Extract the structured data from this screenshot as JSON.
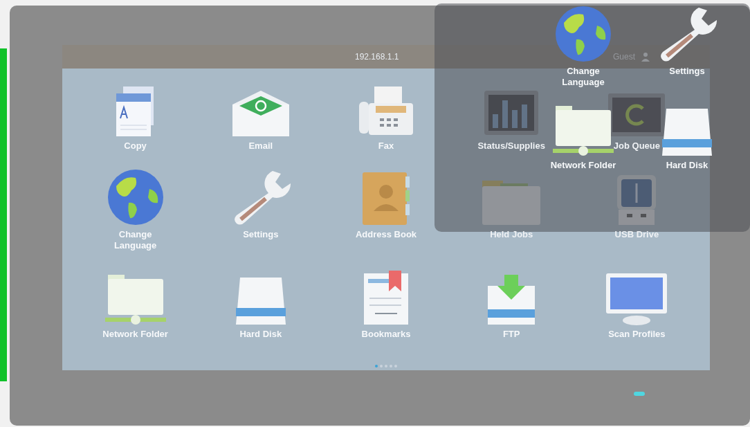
{
  "status_bar": {
    "address": "192.168.1.1",
    "user": "Guest"
  },
  "apps": [
    {
      "label": "Copy",
      "kind": "copy"
    },
    {
      "label": "Email",
      "kind": "email"
    },
    {
      "label": "Fax",
      "kind": "fax"
    },
    {
      "label": "Status/Supplies",
      "kind": "chart"
    },
    {
      "label": "Job Queue",
      "kind": "queue"
    },
    {
      "label": "Change Language",
      "kind": "globe"
    },
    {
      "label": "Settings",
      "kind": "wrench"
    },
    {
      "label": "Address Book",
      "kind": "book"
    },
    {
      "label": "Held Jobs",
      "kind": "folder"
    },
    {
      "label": "USB Drive",
      "kind": "usb"
    },
    {
      "label": "Network Folder",
      "kind": "netfolder"
    },
    {
      "label": "Hard Disk",
      "kind": "disk"
    },
    {
      "label": "Bookmarks",
      "kind": "bookmark"
    },
    {
      "label": "FTP",
      "kind": "ftp"
    },
    {
      "label": "Scan Profiles",
      "kind": "monitor"
    }
  ],
  "page_dots": [
    {
      "selected": true
    },
    {
      "selected": false
    },
    {
      "selected": false
    },
    {
      "selected": false
    },
    {
      "selected": false
    }
  ],
  "overlay": {
    "apps": [
      {
        "label": "Change Language",
        "kind": "globe"
      },
      {
        "label": "Settings",
        "kind": "wrench"
      },
      {
        "label": "Network Folder",
        "kind": "netfolder"
      },
      {
        "label": "Hard Disk",
        "kind": "disk"
      }
    ]
  },
  "indicator_light": {
    "on": true
  }
}
